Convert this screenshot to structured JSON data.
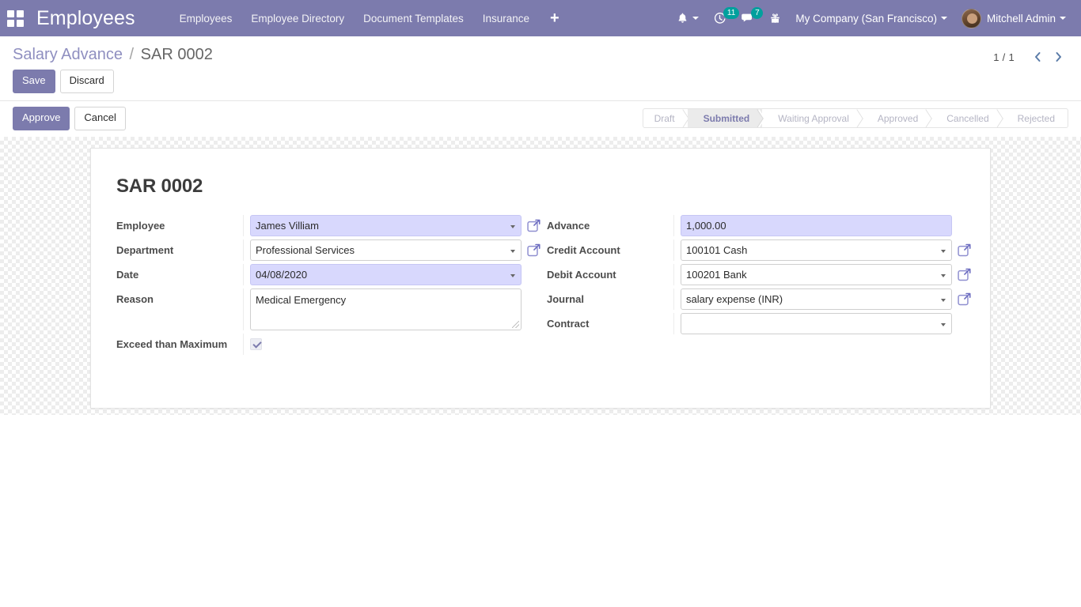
{
  "navbar": {
    "apps_icon": "apps-grid-icon",
    "brand": "Employees",
    "menu_items": [
      {
        "label": "Employees"
      },
      {
        "label": "Employee Directory"
      },
      {
        "label": "Document Templates"
      },
      {
        "label": "Insurance"
      }
    ],
    "add_menu_label": "+",
    "systray": {
      "activities_icon": "bell-icon",
      "clock_icon": "clock-icon",
      "clock_count": "11",
      "messages_icon": "chat-icon",
      "messages_count": "7",
      "gift_icon": "gift-icon",
      "company": "My Company (San Francisco)",
      "user": "Mitchell Admin",
      "avatar_icon": "user-avatar"
    },
    "accent_color": "#7C7BAD",
    "badge_color": "#00A09D"
  },
  "control_panel": {
    "breadcrumb": {
      "parent": "Salary Advance",
      "separator": "/",
      "current": "SAR 0002"
    },
    "pager": {
      "value": "1 / 1",
      "prev_icon": "chevron-left-icon",
      "next_icon": "chevron-right-icon"
    },
    "edit_buttons": {
      "save": "Save",
      "discard": "Discard"
    },
    "workflow_buttons": {
      "approve": "Approve",
      "cancel": "Cancel"
    },
    "statusbar": {
      "stages": [
        {
          "label": "Draft",
          "active": false
        },
        {
          "label": "Submitted",
          "active": true
        },
        {
          "label": "Waiting Approval",
          "active": false
        },
        {
          "label": "Approved",
          "active": false
        },
        {
          "label": "Cancelled",
          "active": false
        },
        {
          "label": "Rejected",
          "active": false
        }
      ],
      "active_color": "#7C7BAD"
    }
  },
  "form": {
    "record_title": "SAR 0002",
    "left_fields": {
      "employee": {
        "label": "Employee",
        "value": "James Villiam",
        "modified": true,
        "external_link": "internal-link-icon"
      },
      "department": {
        "label": "Department",
        "value": "Professional Services",
        "modified": false,
        "external_link": "internal-link-icon"
      },
      "date": {
        "label": "Date",
        "value": "04/08/2020",
        "modified": true
      },
      "reason": {
        "label": "Reason",
        "value": "Medical Emergency",
        "modified": false
      },
      "exceed": {
        "label": "Exceed than Maximum",
        "checked": true
      }
    },
    "right_fields": {
      "advance": {
        "label": "Advance",
        "value": "1,000.00",
        "modified": true
      },
      "credit_account": {
        "label": "Credit Account",
        "value": "100101 Cash",
        "external_link": "internal-link-icon"
      },
      "debit_account": {
        "label": "Debit Account",
        "value": "100201 Bank",
        "external_link": "internal-link-icon"
      },
      "journal": {
        "label": "Journal",
        "value": "salary expense (INR)",
        "external_link": "internal-link-icon"
      },
      "contract": {
        "label": "Contract",
        "value": ""
      }
    },
    "modified_field_color": "#D8D8FD"
  }
}
